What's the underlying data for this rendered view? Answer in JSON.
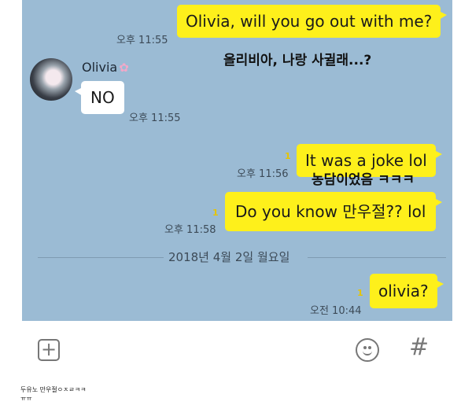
{
  "messages": [
    {
      "text": "Olivia, will you go out with me?",
      "time": "오후 11:55",
      "overlay": "올리비아, 나랑 사귈래...?"
    },
    {
      "sender": "Olivia",
      "text": "NO",
      "time": "오후 11:55"
    },
    {
      "unread": "1",
      "text": "It was a joke lol",
      "time": "오후 11:56",
      "overlay": "농담이었음 ㅋㅋㅋ"
    },
    {
      "unread": "1",
      "text": "Do you know 만우절?? lol",
      "time": "오후 11:58"
    },
    {
      "unread": "1",
      "text": "olivia?",
      "time": "오전 10:44"
    }
  ],
  "date_divider": "2018년 4월 2일 월요일",
  "input_bar": {
    "plus": "+",
    "hash": "#"
  },
  "caption": {
    "line1": "두유노 만우절ㅇㅈㄹㅋㅋ",
    "line2": "ㅠㅠ"
  },
  "colors": {
    "chat_bg": "#9bbbd4",
    "my_bubble": "#fef01b",
    "their_bubble": "#ffffff"
  },
  "icons": [
    "plus-icon",
    "emoticon-icon",
    "hash-icon",
    "flower-icon"
  ]
}
